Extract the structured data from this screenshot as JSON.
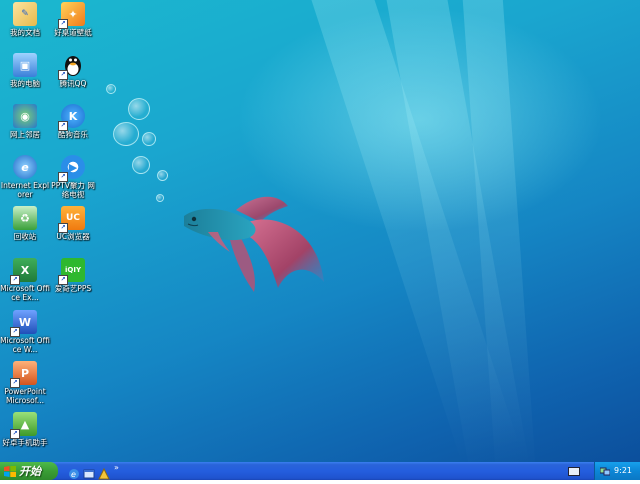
{
  "desktop_icons": [
    {
      "label": "我的文档",
      "icon": "my-documents-icon"
    },
    {
      "label": "好桌道壁纸",
      "icon": "wallpaper-app-icon"
    },
    {
      "label": "我的电脑",
      "icon": "my-computer-icon"
    },
    {
      "label": "腾讯QQ",
      "icon": "qq-icon"
    },
    {
      "label": "网上邻居",
      "icon": "network-places-icon"
    },
    {
      "label": "酷狗音乐",
      "icon": "kugou-music-icon"
    },
    {
      "label": "Internet Explorer",
      "icon": "internet-explorer-icon"
    },
    {
      "label": "PPTV聚力 网络电视",
      "icon": "pptv-icon"
    },
    {
      "label": "回收站",
      "icon": "recycle-bin-icon"
    },
    {
      "label": "UC浏览器",
      "icon": "uc-browser-icon"
    },
    {
      "label": "Microsoft Office Ex...",
      "icon": "excel-icon"
    },
    {
      "label": "爱奇艺PPS",
      "icon": "iqiyi-pps-icon"
    },
    {
      "label": "Microsoft Office W...",
      "icon": "word-icon"
    },
    {
      "label": "PowerPoint Microsof...",
      "icon": "powerpoint-icon"
    },
    {
      "label": "好卓手机助手",
      "icon": "phone-assistant-icon"
    }
  ],
  "taskbar": {
    "start_label": "开始",
    "quick_launch": [
      "internet-explorer-icon",
      "show-desktop-icon",
      "media-icon"
    ],
    "overflow_label": "»",
    "clock": "9:21"
  },
  "colors": {
    "taskbar": "#245ede",
    "start_button": "#3a9e36",
    "tray": "#0c86d6"
  }
}
